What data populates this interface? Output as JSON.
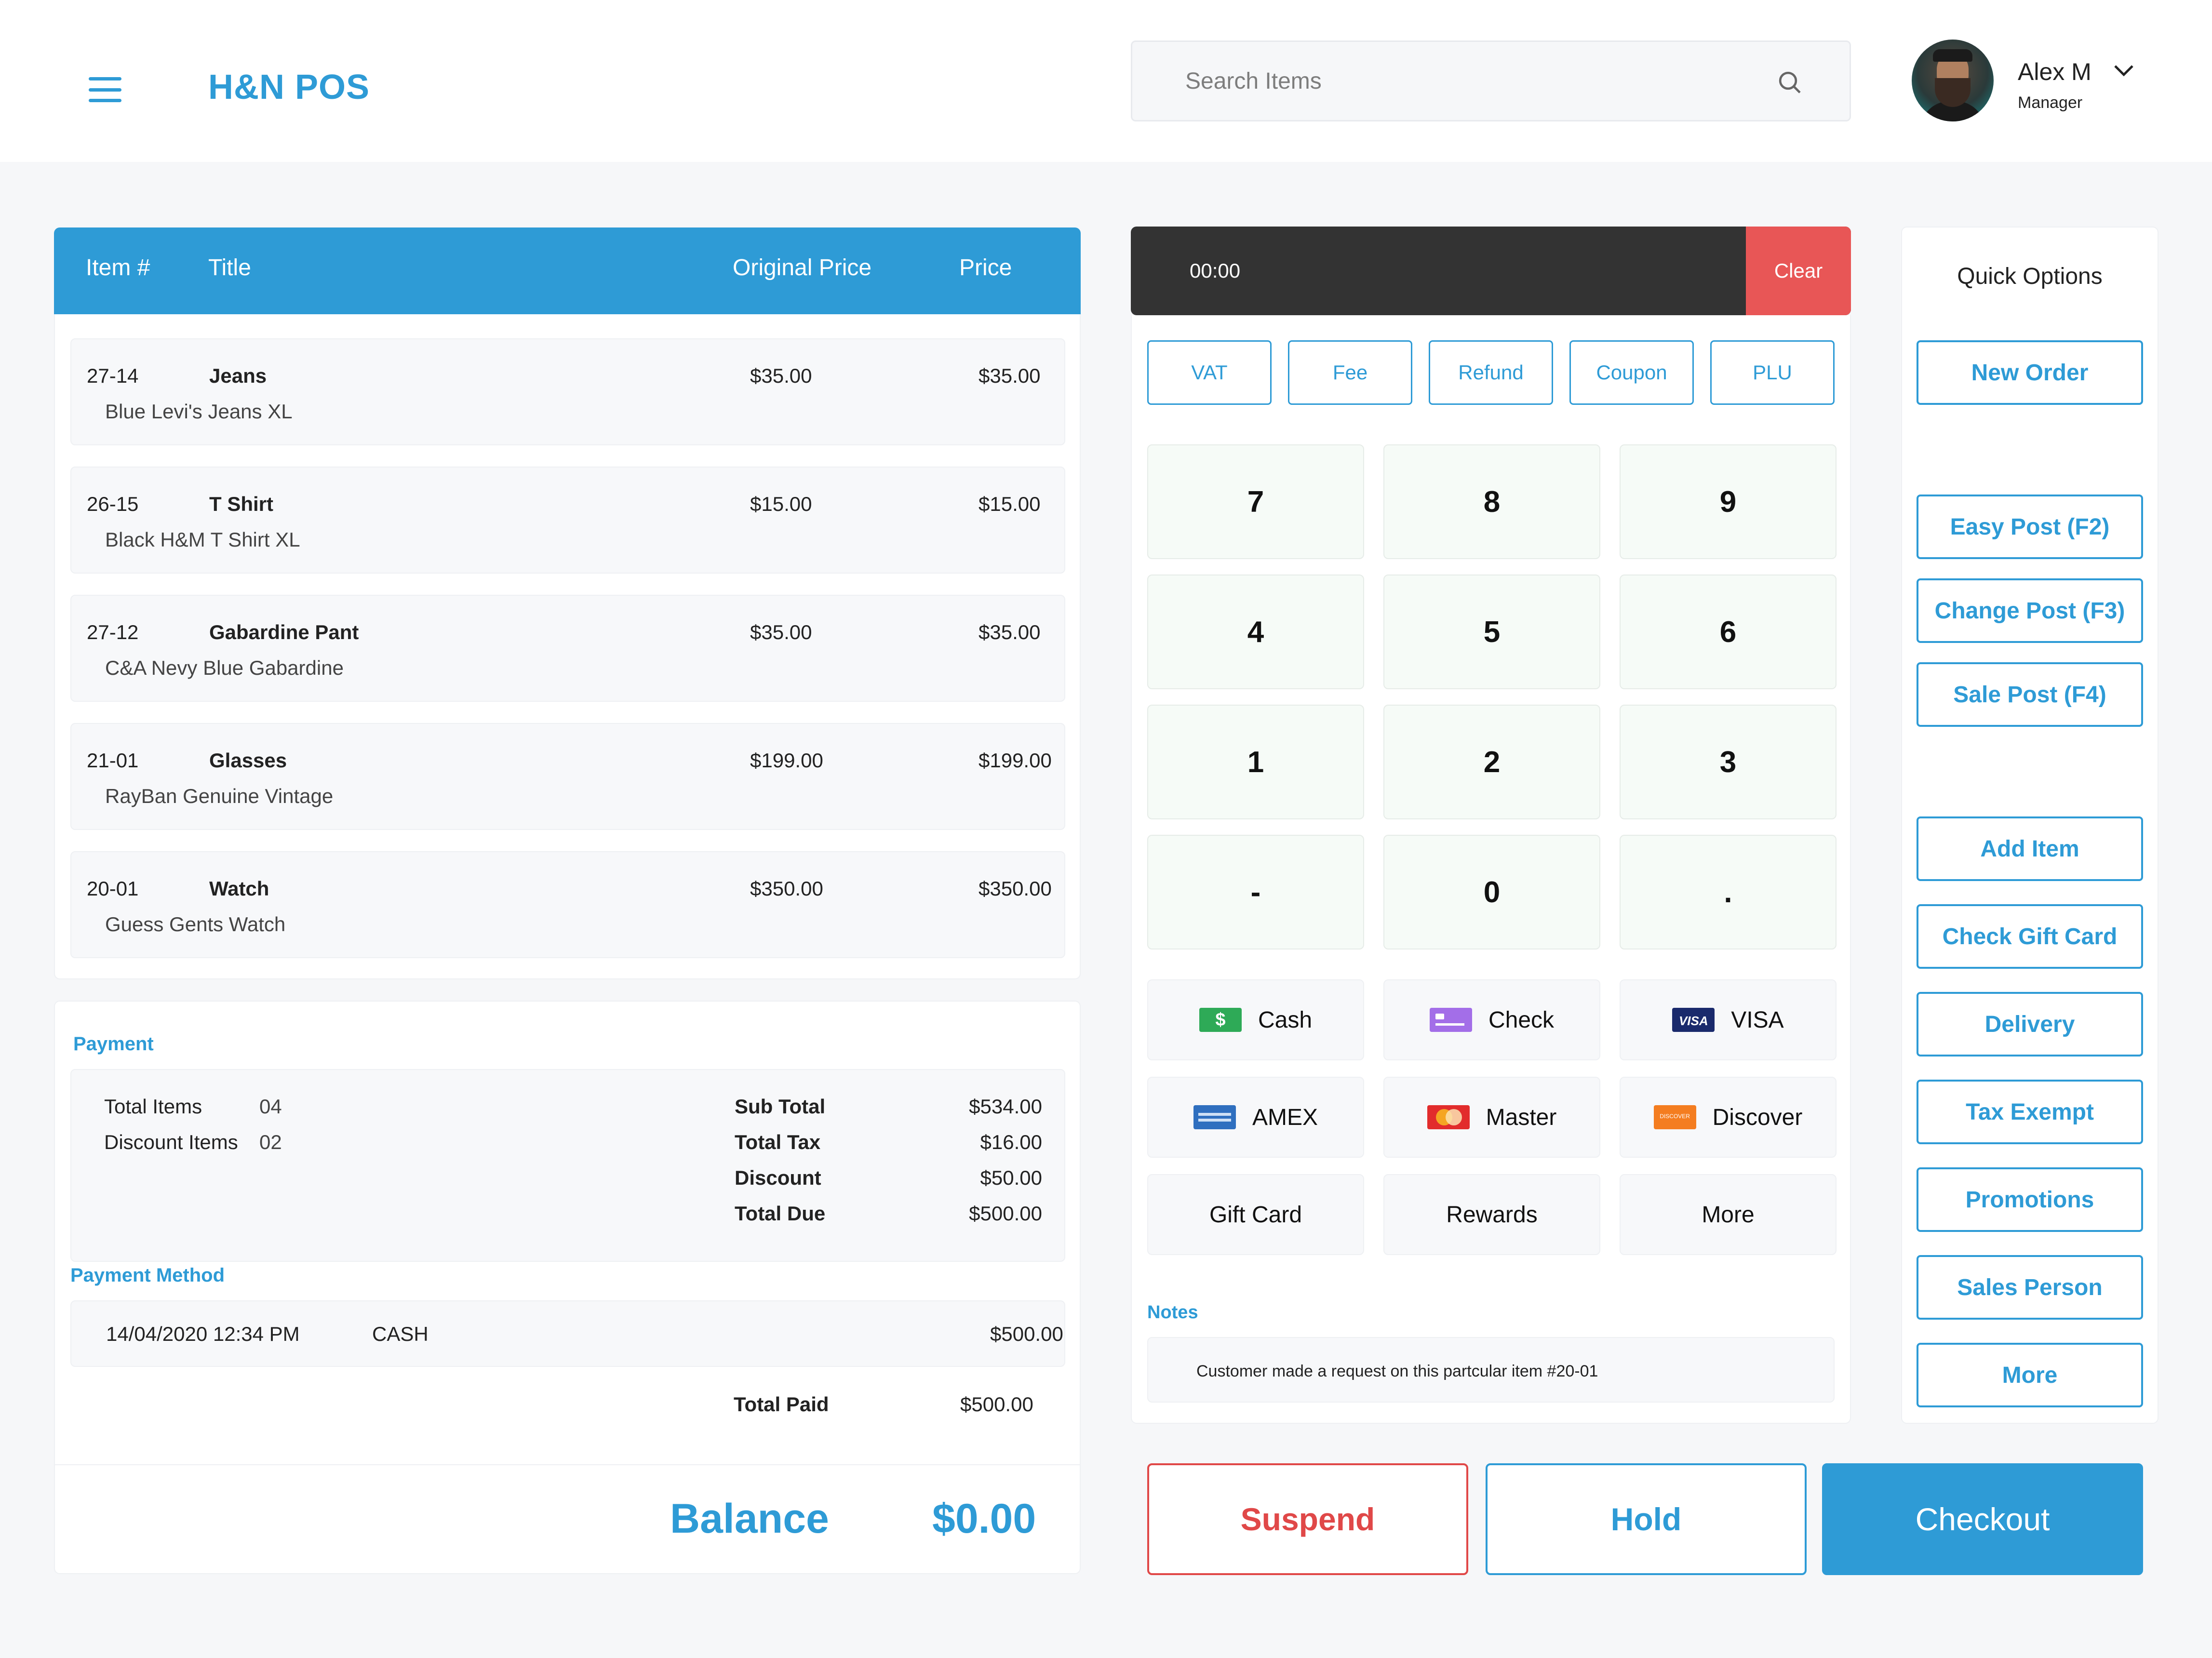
{
  "app": {
    "brand": "H&N POS"
  },
  "search": {
    "placeholder": "Search Items"
  },
  "user": {
    "name": "Alex M",
    "role": "Manager"
  },
  "items_table": {
    "columns": [
      "Item #",
      "Title",
      "Original Price",
      "Price"
    ],
    "rows": [
      {
        "number": "27-14",
        "title": "Jeans",
        "description": "Blue Levi's Jeans XL",
        "original_price": "$35.00",
        "price": "$35.00"
      },
      {
        "number": "26-15",
        "title": "T Shirt",
        "description": "Black H&M T Shirt XL",
        "original_price": "$15.00",
        "price": "$15.00"
      },
      {
        "number": "27-12",
        "title": "Gabardine Pant",
        "description": "C&A Nevy Blue Gabardine",
        "original_price": "$35.00",
        "price": "$35.00"
      },
      {
        "number": "21-01",
        "title": "Glasses",
        "description": "RayBan Genuine Vintage",
        "original_price": "$199.00",
        "price": "$199.00"
      },
      {
        "number": "20-01",
        "title": "Watch",
        "description": "Guess Gents Watch",
        "original_price": "$350.00",
        "price": "$350.00"
      }
    ]
  },
  "payment": {
    "label": "Payment",
    "total_items_label": "Total Items",
    "total_items_value": "04",
    "discount_items_label": "Discount Items",
    "discount_items_value": "02",
    "sub_total_label": "Sub Total",
    "sub_total_value": "$534.00",
    "total_tax_label": "Total Tax",
    "total_tax_value": "$16.00",
    "discount_label": "Discount",
    "discount_value": "$50.00",
    "total_due_label": "Total Due",
    "total_due_value": "$500.00",
    "method_label": "Payment Method",
    "method": {
      "datetime": "14/04/2020 12:34 PM",
      "type": "CASH",
      "amount": "$500.00"
    },
    "total_paid_label": "Total Paid",
    "total_paid_value": "$500.00",
    "balance_label": "Balance",
    "balance_value": "$0.00"
  },
  "timer": {
    "value": "00:00",
    "clear_label": "Clear"
  },
  "modifiers": [
    "VAT",
    "Fee",
    "Refund",
    "Coupon",
    "PLU"
  ],
  "keypad": [
    "7",
    "8",
    "9",
    "4",
    "5",
    "6",
    "1",
    "2",
    "3",
    "-",
    "0",
    "."
  ],
  "payment_methods": [
    {
      "label": "Cash",
      "icon": "cash-icon"
    },
    {
      "label": "Check",
      "icon": "check-icon"
    },
    {
      "label": "VISA",
      "icon": "visa-icon"
    },
    {
      "label": "AMEX",
      "icon": "amex-icon"
    },
    {
      "label": "Master",
      "icon": "mastercard-icon"
    },
    {
      "label": "Discover",
      "icon": "discover-icon"
    },
    {
      "label": "Gift Card"
    },
    {
      "label": "Rewards"
    },
    {
      "label": "More"
    }
  ],
  "icon_text": {
    "visa": "VISA",
    "discover": "DISCOVER"
  },
  "notes": {
    "label": "Notes",
    "text": "Customer made a request on this partcular item #20-01"
  },
  "quick_options": {
    "title": "Quick Options",
    "buttons": [
      "New Order",
      "Easy Post (F2)",
      "Change Post (F3)",
      "Sale Post (F4)",
      "Add Item",
      "Check Gift Card",
      "Delivery",
      "Tax Exempt",
      "Promotions",
      "Sales Person",
      "More"
    ]
  },
  "actions": {
    "suspend": "Suspend",
    "hold": "Hold",
    "checkout": "Checkout"
  },
  "colors": {
    "accent": "#2e9bd6",
    "danger": "#e04848",
    "clear": "#e85656",
    "timer_bg": "#333333"
  }
}
